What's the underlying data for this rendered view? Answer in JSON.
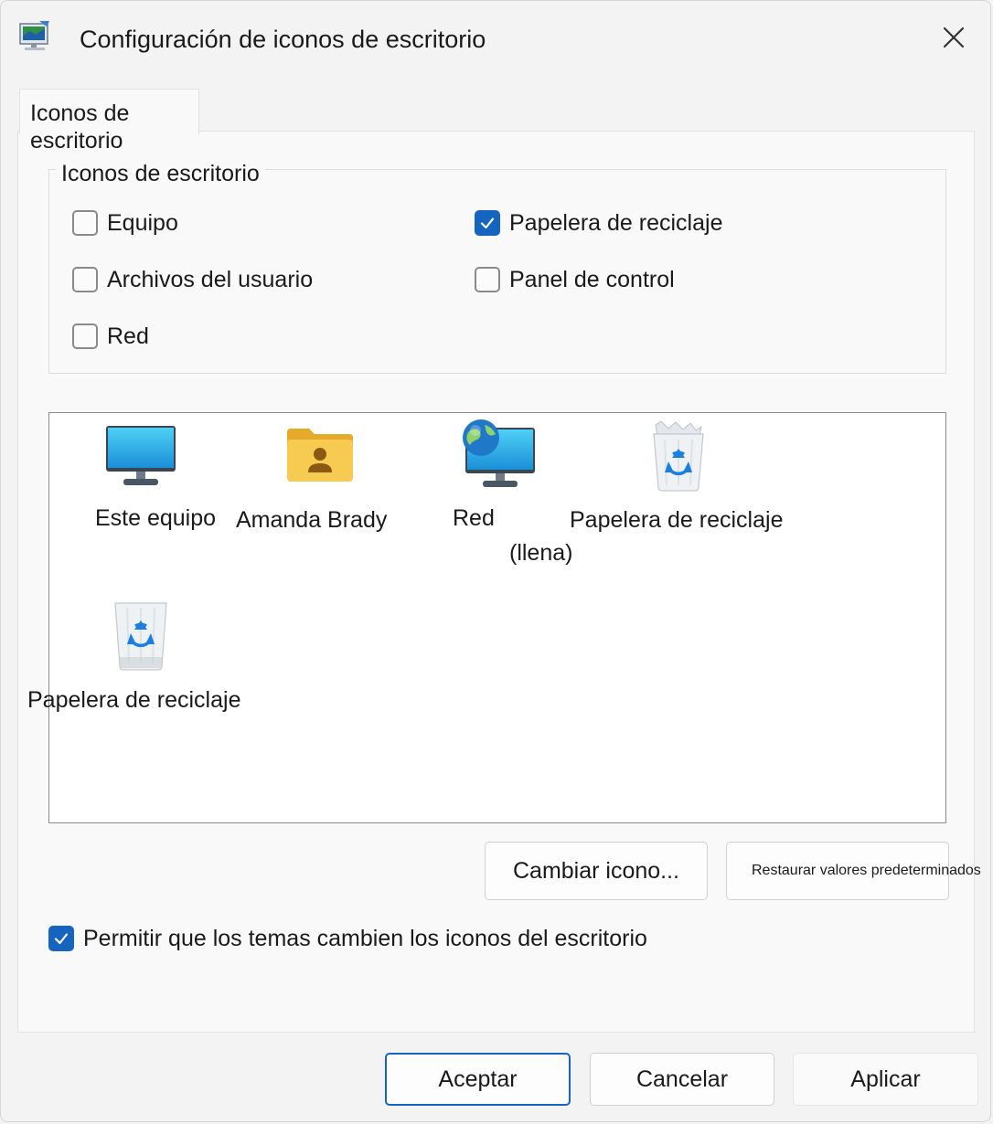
{
  "window": {
    "title": "Configuración de iconos de escritorio",
    "app_icon": "desktop-settings-icon",
    "close_icon": "close-icon"
  },
  "tab": {
    "label": "Iconos de escritorio"
  },
  "group": {
    "legend": "Iconos de escritorio",
    "checkboxes": [
      {
        "label": "Equipo",
        "checked": false
      },
      {
        "label": "Papelera de reciclaje",
        "checked": true
      },
      {
        "label": "Archivos del usuario",
        "checked": false
      },
      {
        "label": "Panel de control",
        "checked": false
      },
      {
        "label": "Red",
        "checked": false
      }
    ]
  },
  "preview": {
    "items": [
      {
        "label": "Este equipo",
        "icon": "monitor-icon"
      },
      {
        "label": "Amanda Brady",
        "icon": "user-folder-icon"
      },
      {
        "label": "Red",
        "icon": "network-monitor-icon"
      },
      {
        "label": "Papelera de reciclaje",
        "icon": "recycle-bin-full-icon"
      },
      {
        "label": "(llena)"
      },
      {
        "label": "Papelera de reciclaje",
        "icon": "recycle-bin-empty-icon"
      }
    ]
  },
  "buttons": {
    "change_icon": "Cambiar icono...",
    "restore_defaults": "Restaurar valores predeterminados",
    "ok": "Aceptar",
    "cancel": "Cancelar",
    "apply": "Aplicar"
  },
  "allow_themes": {
    "label": "Permitir que los temas cambien los iconos del escritorio",
    "checked": true
  },
  "colors": {
    "accent": "#1565c0",
    "window_bg": "#f3f3f3",
    "panel_bg": "#f9f9f9"
  }
}
